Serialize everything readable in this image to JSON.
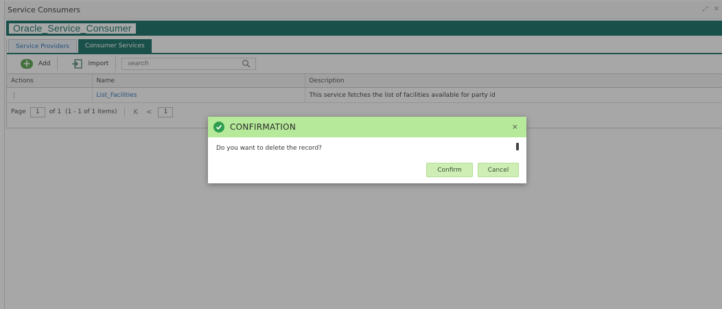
{
  "window": {
    "title": "Service Consumers",
    "controls": [
      "⤢",
      "✕"
    ]
  },
  "consumer": {
    "name": "Oracle_Service_Consumer"
  },
  "tabs": [
    {
      "label": "Service Providers",
      "active": false
    },
    {
      "label": "Consumer Services",
      "active": true
    }
  ],
  "toolbar": {
    "add_label": "Add",
    "import_label": "Import",
    "search_placeholder": "search"
  },
  "table": {
    "columns": [
      "Actions",
      "Name",
      "Description"
    ],
    "rows": [
      {
        "actions": "⋮",
        "name": "List_Facilities",
        "description": "This service fetches the list of facilities available for party id"
      }
    ]
  },
  "pager": {
    "page_label": "Page",
    "page_value": "1",
    "of_label": "of 1",
    "items_label": "(1 - 1 of 1 items)",
    "first": "K",
    "prev": "<",
    "current": "1"
  },
  "dialog": {
    "title": "CONFIRMATION",
    "close": "×",
    "message": "Do you want to delete the record?",
    "confirm_label": "Confirm",
    "cancel_label": "Cancel"
  },
  "colors": {
    "brand_teal": "#0c6b5f",
    "link_blue": "#1f6bb5",
    "dialog_header": "#b6ea9a",
    "success_check": "#2f9e4e",
    "button_green": "#cfeeb6"
  }
}
